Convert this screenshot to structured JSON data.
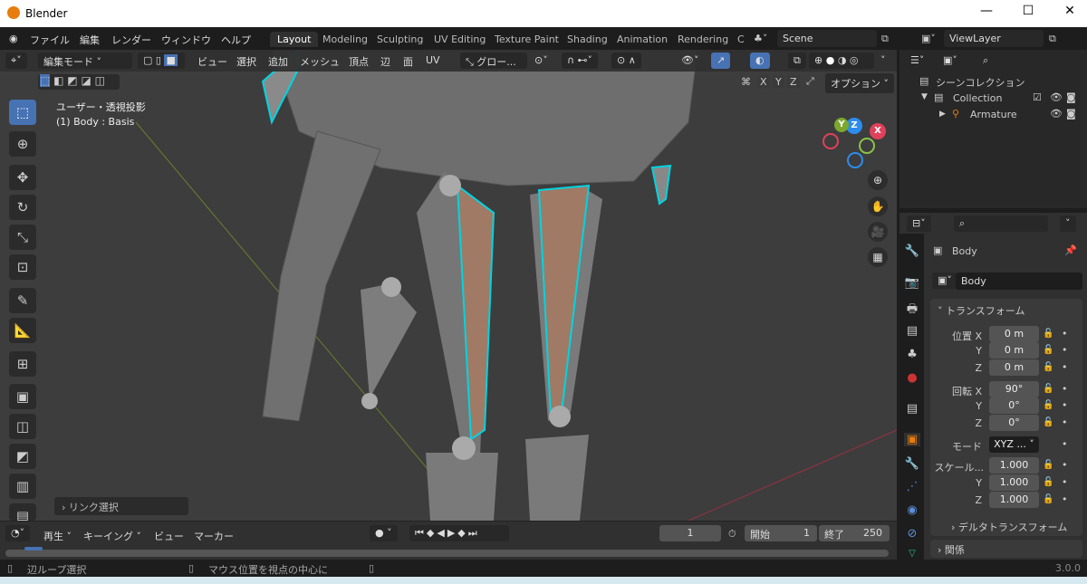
{
  "window": {
    "title": "Blender",
    "minimize": "—",
    "maximize": "☐",
    "close": "✕"
  },
  "menu": [
    "ファイル",
    "編集",
    "レンダー",
    "ウィンドウ",
    "ヘルプ"
  ],
  "workspaces": [
    "Layout",
    "Modeling",
    "Sculpting",
    "UV Editing",
    "Texture Paint",
    "Shading",
    "Animation",
    "Rendering",
    "C"
  ],
  "scene": "Scene",
  "view_layer": "ViewLayer",
  "viewport_header": {
    "mode": "編集モード",
    "menus": [
      "ビュー",
      "選択",
      "追加",
      "メッシュ",
      "頂点",
      "辺",
      "面",
      "UV"
    ],
    "transform_orientation": "グロー...",
    "options": "オプション",
    "axes": [
      "X",
      "Y",
      "Z"
    ]
  },
  "viewport": {
    "view_name": "ユーザー・透視投影",
    "object_info": "(1) Body : Basis",
    "last_op": "リンク選択",
    "gizmo_axes": [
      "X",
      "Y",
      "Z"
    ]
  },
  "outliner": {
    "scene_collection": "シーンコレクション",
    "items": [
      {
        "name": "Collection"
      },
      {
        "name": "Armature"
      }
    ]
  },
  "properties": {
    "object_name": "Body",
    "data_name": "Body",
    "transform_panel": "トランスフォーム",
    "location": {
      "label": "位置 X",
      "x": "0 m",
      "y": "0 m",
      "z": "0 m"
    },
    "rotation": {
      "label": "回転 X",
      "x": "90°",
      "y": "0°",
      "z": "0°"
    },
    "mode_label": "モード",
    "mode": "XYZ ...",
    "scale": {
      "label": "スケール...",
      "x": "1.000",
      "y": "1.000",
      "z": "1.000"
    },
    "y": "Y",
    "z": "Z",
    "delta": "デルタトランスフォーム",
    "relations": "関係"
  },
  "timeline": {
    "menus": [
      "再生",
      "キーイング",
      "ビュー",
      "マーカー"
    ],
    "current_frame": "1",
    "start_label": "開始",
    "start": "1",
    "end_label": "終了",
    "end": "250"
  },
  "status": {
    "left": "辺ループ選択",
    "middle": "マウス位置を視点の中心に",
    "version": "3.0.0"
  },
  "colors": {
    "accent": "#4772b3",
    "selection": "#00d4e0",
    "x_axis": "#e0415a",
    "y_axis": "#8bc34a",
    "z_axis": "#2d8ceb",
    "object": "#e87d0d"
  }
}
